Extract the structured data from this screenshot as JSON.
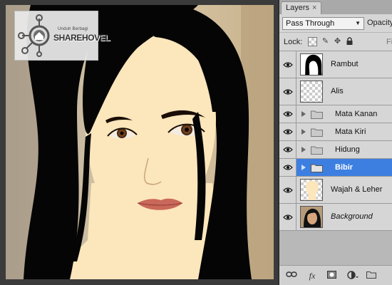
{
  "watermark": {
    "brand": "SHAREHOVEL",
    "tagline": "Unduh Berbagi"
  },
  "layers_panel": {
    "tab_label": "Layers",
    "tab_close": "×",
    "blend_mode": "Pass Through",
    "opacity_label": "Opacity",
    "lock_label": "Lock:",
    "fill_label": "Fil",
    "selection_color": "#3d7fe0",
    "layers": [
      {
        "name": "Rambut",
        "kind": "pixel",
        "thumb": "hair",
        "visible": true,
        "selected": false
      },
      {
        "name": "Alis",
        "kind": "pixel",
        "thumb": "empty",
        "visible": true,
        "selected": false
      },
      {
        "name": "Mata Kanan",
        "kind": "group",
        "visible": true,
        "selected": false
      },
      {
        "name": "Mata Kiri",
        "kind": "group",
        "visible": true,
        "selected": false
      },
      {
        "name": "Hidung",
        "kind": "group",
        "visible": true,
        "selected": false
      },
      {
        "name": "Bibir",
        "kind": "group",
        "visible": true,
        "selected": true
      },
      {
        "name": "Wajah & Leher",
        "kind": "pixel",
        "thumb": "skin",
        "visible": true,
        "selected": false
      },
      {
        "name": "Background",
        "kind": "background",
        "thumb": "photo",
        "visible": true,
        "selected": false
      }
    ],
    "bottom_icons": [
      "link-icon",
      "fx-icon",
      "mask-icon",
      "adjustment-icon",
      "folder-icon"
    ],
    "bottom_fx": "fx"
  }
}
